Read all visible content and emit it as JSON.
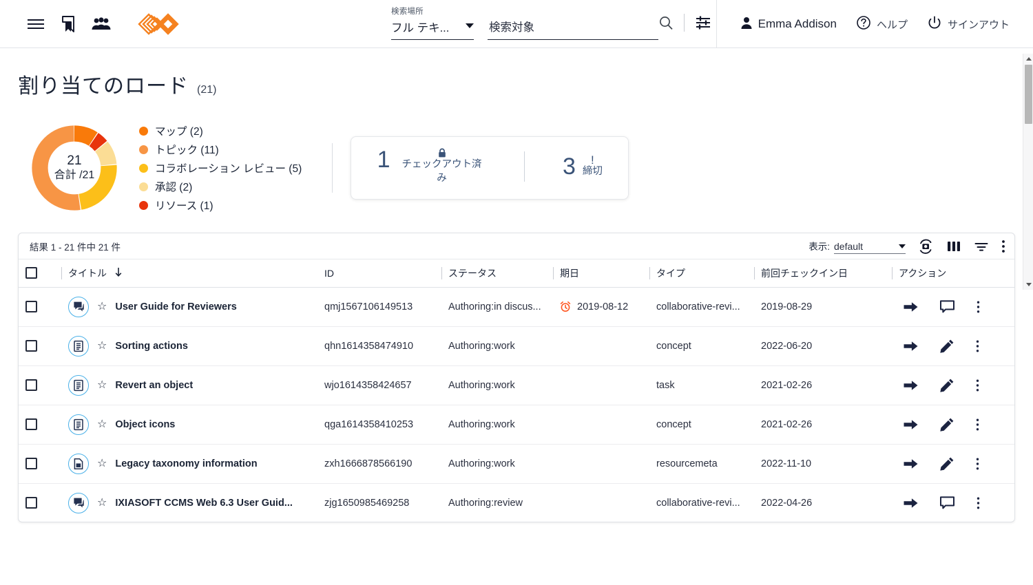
{
  "header": {
    "icons": [
      {
        "name": "hamburger-menu-icon",
        "label": "menu"
      },
      {
        "name": "bookmark-icon",
        "label": "bookmarks"
      },
      {
        "name": "people-icon",
        "label": "teams"
      }
    ],
    "logo_name": "ixiasoft-logo",
    "search": {
      "scope_label": "検索場所",
      "scope_value": "フル テキ...",
      "query_value": "",
      "query_placeholder": "検索対象",
      "search_icon": "search-icon",
      "filter_icon": "search-settings-icon"
    },
    "user": {
      "name": "Emma Addison",
      "avatar_icon": "person-icon"
    },
    "help_label": "ヘルプ",
    "help_icon": "question-circle-icon",
    "signout_label": "サインアウト",
    "signout_icon": "power-icon"
  },
  "page": {
    "title": "割り当てのロード",
    "count": "(21)"
  },
  "chart_data": {
    "type": "pie",
    "title": "割り当てのロード",
    "center_total": "21",
    "center_sub": "合計 /21",
    "categories": [
      "マップ",
      "トピック",
      "コラボレーション レビュー",
      "承認",
      "リソース"
    ],
    "values": [
      2,
      11,
      5,
      2,
      1
    ],
    "colors": [
      "#f97a0a",
      "#f79545",
      "#fcbf19",
      "#fbdd95",
      "#e8340c"
    ],
    "legend": [
      {
        "label": "マップ (2)",
        "color": "#f97a0a"
      },
      {
        "label": "トピック (11)",
        "color": "#f79545"
      },
      {
        "label": "コラボレーション レビュー (5)",
        "color": "#fcbf19"
      },
      {
        "label": "承認 (2)",
        "color": "#fbdd95"
      },
      {
        "label": "リソース (1)",
        "color": "#e8340c"
      }
    ],
    "total": 21,
    "legend_position": "right",
    "grid": false
  },
  "stats": {
    "checked_out": {
      "number": "1",
      "label": "チェックアウト済み",
      "icon": "lock-icon"
    },
    "deadline": {
      "number": "3",
      "label": "締切",
      "icon": "exclamation-icon"
    }
  },
  "table": {
    "results_text": "結果 1 - 21 件中 21 件",
    "view_label": "表示:",
    "view_value": "default",
    "toolbar_icons": [
      {
        "name": "refresh-camera-icon"
      },
      {
        "name": "columns-icon"
      },
      {
        "name": "filter-icon"
      },
      {
        "name": "more-vertical-icon"
      }
    ],
    "columns": [
      {
        "key": "title",
        "label": "タイトル",
        "sorted": "desc"
      },
      {
        "key": "id",
        "label": "ID"
      },
      {
        "key": "status",
        "label": "ステータス"
      },
      {
        "key": "due",
        "label": "期日"
      },
      {
        "key": "type",
        "label": "タイプ"
      },
      {
        "key": "checkin",
        "label": "前回チェックイン日"
      },
      {
        "key": "actions",
        "label": "アクション"
      }
    ],
    "rows": [
      {
        "icon": "comment-document-icon",
        "title": "User Guide for Reviewers",
        "id": "qmj1567106149513",
        "status": "Authoring:in discus...",
        "due": "2019-08-12",
        "due_alert": true,
        "type": "collaborative-revi...",
        "checkin": "2019-08-29",
        "actions": [
          "arrow-right-icon",
          "comment-icon",
          "more-vertical-icon"
        ]
      },
      {
        "icon": "topic-document-icon",
        "title": "Sorting actions",
        "id": "qhn1614358474910",
        "status": "Authoring:work",
        "due": "",
        "due_alert": false,
        "type": "concept",
        "checkin": "2022-06-20",
        "actions": [
          "arrow-right-icon",
          "pencil-icon",
          "more-vertical-icon"
        ]
      },
      {
        "icon": "topic-document-icon",
        "title": "Revert an object",
        "id": "wjo1614358424657",
        "status": "Authoring:work",
        "due": "",
        "due_alert": false,
        "type": "task",
        "checkin": "2021-02-26",
        "actions": [
          "arrow-right-icon",
          "pencil-icon",
          "more-vertical-icon"
        ]
      },
      {
        "icon": "topic-document-icon",
        "title": "Object icons",
        "id": "qga1614358410253",
        "status": "Authoring:work",
        "due": "",
        "due_alert": false,
        "type": "concept",
        "checkin": "2021-02-26",
        "actions": [
          "arrow-right-icon",
          "pencil-icon",
          "more-vertical-icon"
        ]
      },
      {
        "icon": "resource-document-icon",
        "title": "Legacy taxonomy information",
        "id": "zxh1666878566190",
        "status": "Authoring:work",
        "due": "",
        "due_alert": false,
        "type": "resourcemeta",
        "checkin": "2022-11-10",
        "actions": [
          "arrow-right-icon",
          "pencil-icon",
          "more-vertical-icon"
        ]
      },
      {
        "icon": "comment-document-icon",
        "title": "IXIASOFT CCMS Web 6.3 User Guid...",
        "id": "zjg1650985469258",
        "status": "Authoring:review",
        "due": "",
        "due_alert": false,
        "type": "collaborative-revi...",
        "checkin": "2022-04-26",
        "actions": [
          "arrow-right-icon",
          "comment-icon",
          "more-vertical-icon"
        ]
      }
    ]
  },
  "colors": {
    "brand_orange": "#f58220",
    "accent_blue": "#49b0e8",
    "stat_blue": "#3a5378",
    "alert_red": "#ff5722",
    "text_dark": "#1b2436"
  }
}
